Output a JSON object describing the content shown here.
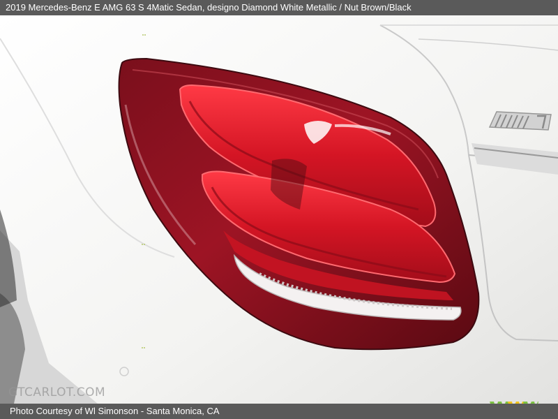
{
  "header": {
    "caption": "2019 Mercedes-Benz E AMG 63 S 4Matic Sedan,  designo Diamond White Metallic / Nut Brown/Black"
  },
  "photo": {
    "subject": "tail-light",
    "watermark": "GTCARLOT.COM"
  },
  "footer": {
    "credit": "Photo Courtesy of Wl Simonson - Santa Monica, CA"
  },
  "colors": {
    "bar_bg": "#5a5a5a",
    "lamp_red": "#d41524",
    "lamp_dark": "#5e0a14",
    "body_white": "#f4f4f2",
    "logo_green": "#7cc242",
    "logo_yellow": "#f2c21a"
  },
  "icons": {
    "brand_logo": "wmm-logo"
  }
}
